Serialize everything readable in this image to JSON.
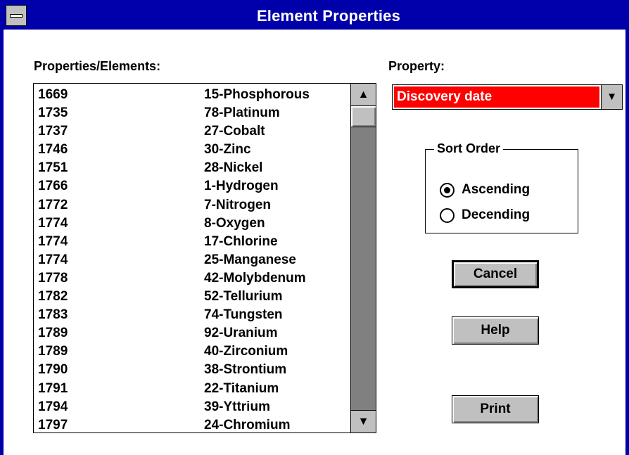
{
  "window": {
    "title": "Element Properties"
  },
  "list": {
    "label": "Properties/Elements:",
    "rows": [
      {
        "value": "1669",
        "element": "15-Phosphorous"
      },
      {
        "value": "1735",
        "element": "78-Platinum"
      },
      {
        "value": "1737",
        "element": "27-Cobalt"
      },
      {
        "value": "1746",
        "element": "30-Zinc"
      },
      {
        "value": "1751",
        "element": "28-Nickel"
      },
      {
        "value": "1766",
        "element": "1-Hydrogen"
      },
      {
        "value": "1772",
        "element": "7-Nitrogen"
      },
      {
        "value": "1774",
        "element": "8-Oxygen"
      },
      {
        "value": "1774",
        "element": "17-Chlorine"
      },
      {
        "value": "1774",
        "element": "25-Manganese"
      },
      {
        "value": "1778",
        "element": "42-Molybdenum"
      },
      {
        "value": "1782",
        "element": "52-Tellurium"
      },
      {
        "value": "1783",
        "element": "74-Tungsten"
      },
      {
        "value": "1789",
        "element": "92-Uranium"
      },
      {
        "value": "1789",
        "element": "40-Zirconium"
      },
      {
        "value": "1790",
        "element": "38-Strontium"
      },
      {
        "value": "1791",
        "element": "22-Titanium"
      },
      {
        "value": "1794",
        "element": "39-Yttrium"
      },
      {
        "value": "1797",
        "element": "24-Chromium"
      }
    ],
    "scroll_up_icon": "▲",
    "scroll_down_icon": "▼"
  },
  "property": {
    "label": "Property:",
    "selected": "Discovery date",
    "dropdown_icon": "▼",
    "highlight_color": "#ff0000"
  },
  "sort": {
    "legend": "Sort Order",
    "options": [
      {
        "label": "Ascending",
        "checked": true
      },
      {
        "label": "Decending",
        "checked": false
      }
    ]
  },
  "buttons": {
    "cancel": "Cancel",
    "help": "Help",
    "print": "Print"
  },
  "colors": {
    "titlebar": "#0000aa",
    "face": "#c0c0c0"
  }
}
